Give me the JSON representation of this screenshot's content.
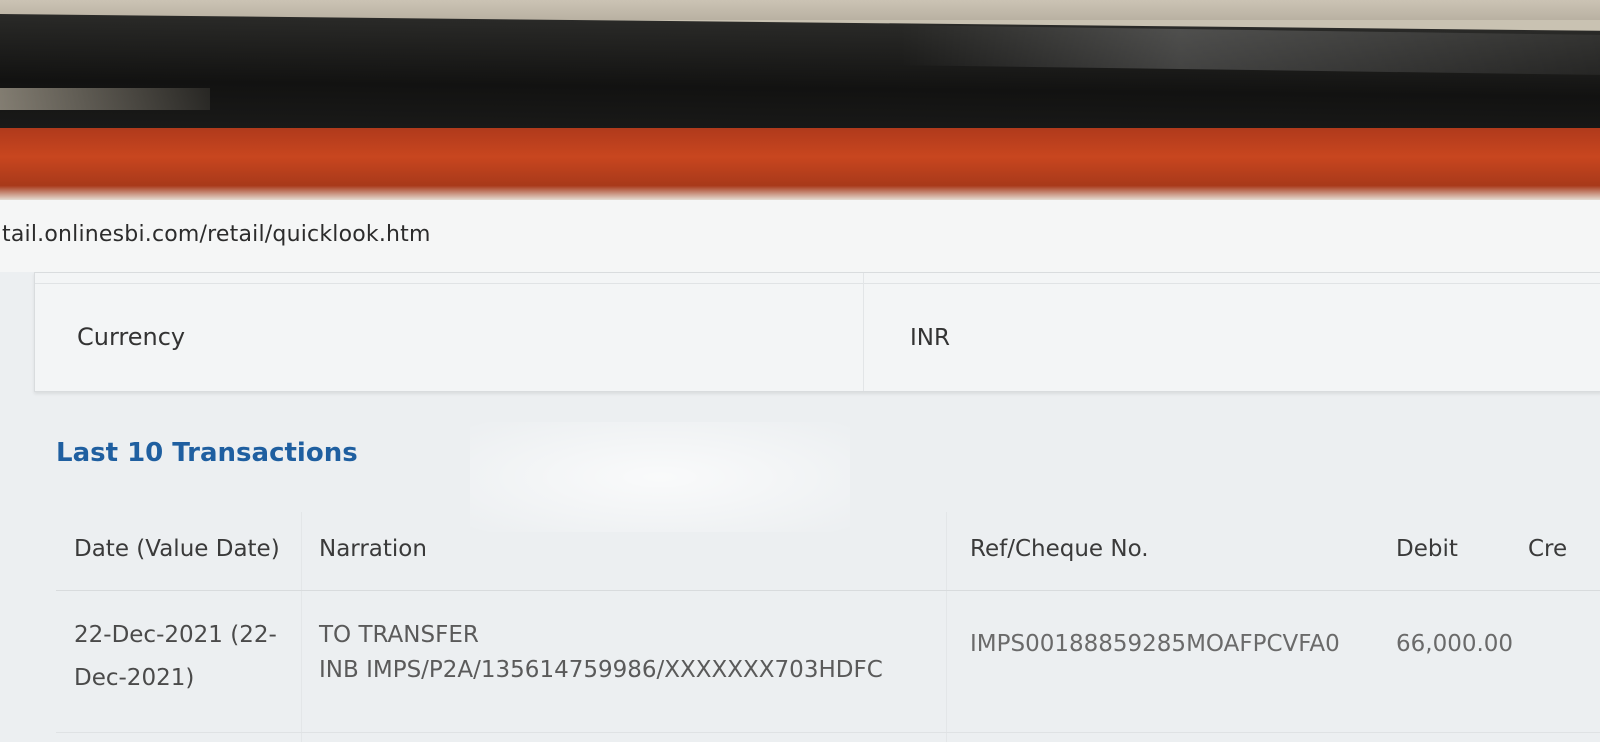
{
  "browser": {
    "url": "tail.onlinesbi.com/retail/quicklook.htm"
  },
  "summary": {
    "currency_label": "Currency",
    "currency_value": "INR"
  },
  "transactions": {
    "title": "Last 10 Transactions",
    "columns": {
      "date": "Date (Value Date)",
      "narration": "Narration",
      "ref": "Ref/Cheque No.",
      "debit": "Debit",
      "credit": "Cre"
    },
    "rows": [
      {
        "date_line1": "22-Dec-2021 (22-",
        "date_line2": "Dec-2021)",
        "narration_line1": "TO TRANSFER",
        "narration_line2": "INB IMPS/P2A/135614759986/XXXXXXX703HDFC",
        "ref": "IMPS00188859285MOAFPCVFA0",
        "debit": "66,000.00"
      }
    ]
  },
  "colors": {
    "title_blue": "#1f5fa0",
    "browser_red": "#c8461f"
  }
}
